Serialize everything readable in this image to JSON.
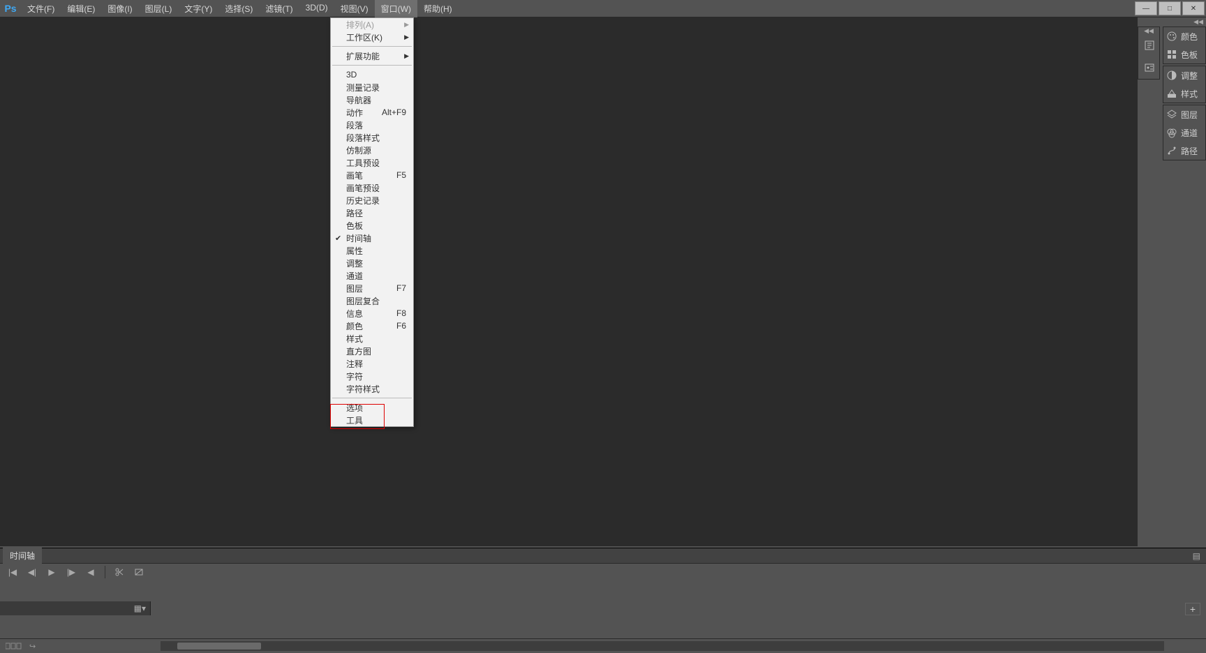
{
  "app": {
    "logo": "Ps"
  },
  "menu": {
    "file": "文件(F)",
    "edit": "编辑(E)",
    "image": "图像(I)",
    "layer": "图层(L)",
    "type": "文字(Y)",
    "select": "选择(S)",
    "filter": "滤镜(T)",
    "threeD": "3D(D)",
    "view": "视图(V)",
    "window": "窗口(W)",
    "help": "帮助(H)"
  },
  "windowMenu": {
    "arrange": "排列(A)",
    "workspace": "工作区(K)",
    "extensions": "扩展功能",
    "threeD": "3D",
    "measureLog": "测量记录",
    "navigator": "导航器",
    "actions": {
      "label": "动作",
      "shortcut": "Alt+F9"
    },
    "paragraph": "段落",
    "paraStyles": "段落样式",
    "cloneSrc": "仿制源",
    "toolPreset": "工具预设",
    "brush": {
      "label": "画笔",
      "shortcut": "F5"
    },
    "brushPreset": "画笔预设",
    "history": "历史记录",
    "paths": "路径",
    "swatches": "色板",
    "timeline": "时间轴",
    "properties": "属性",
    "adjust": "调整",
    "channels": "通道",
    "layers": {
      "label": "图层",
      "shortcut": "F7"
    },
    "layerComps": "图层复合",
    "info": {
      "label": "信息",
      "shortcut": "F8"
    },
    "color": {
      "label": "颜色",
      "shortcut": "F6"
    },
    "styles": "样式",
    "histogram": "直方图",
    "notes": "注释",
    "character": "字符",
    "charStyles": "字符样式",
    "options": "选项",
    "tools": "工具"
  },
  "panels": {
    "color": "颜色",
    "swatches": "色板",
    "adjust": "调整",
    "styles": "样式",
    "layers": "图层",
    "channels": "通道",
    "paths": "路径"
  },
  "timeline": {
    "title": "时间轴",
    "add": "+"
  },
  "windowControls": {
    "min": "—",
    "max": "□",
    "close": "✕"
  }
}
